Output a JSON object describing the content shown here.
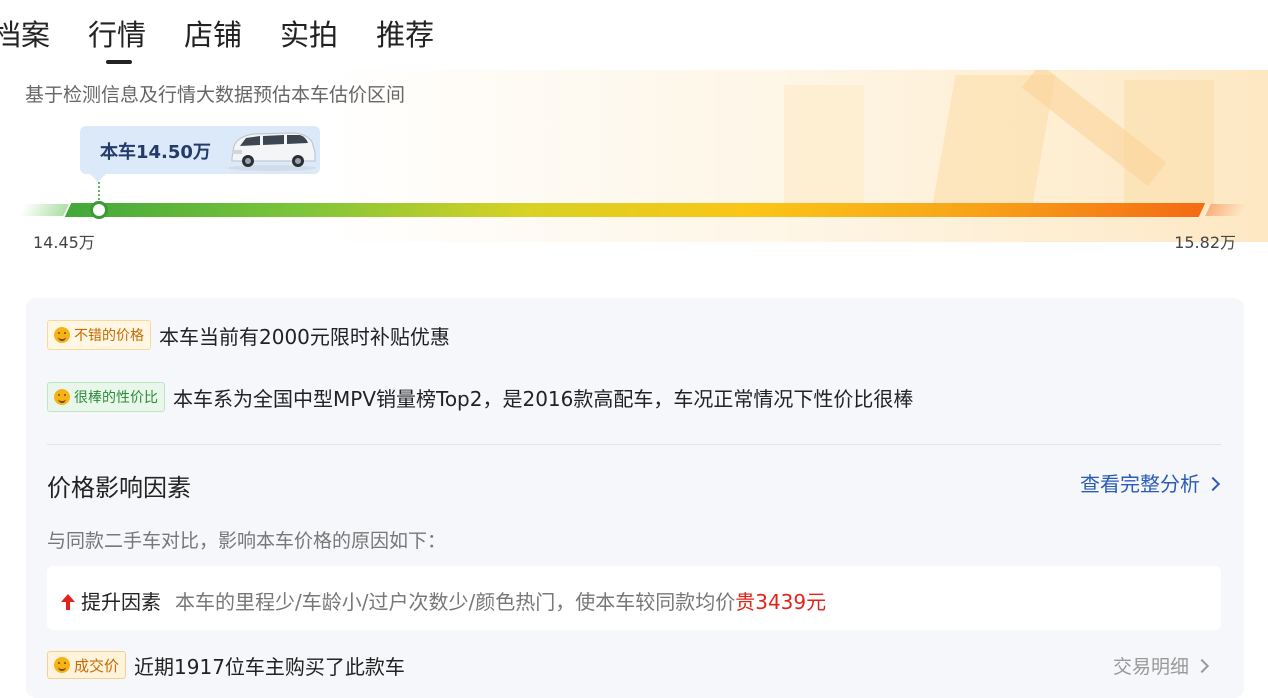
{
  "tabs": [
    {
      "label": "档案"
    },
    {
      "label": "行情"
    },
    {
      "label": "店铺"
    },
    {
      "label": "实拍"
    },
    {
      "label": "推荐"
    }
  ],
  "active_tab": "行情",
  "valuation": {
    "subtitle": "基于检测信息及行情大数据预估本车估价区间",
    "car_price_label": "本车14.50万",
    "range_min": "14.45万",
    "range_max": "15.82万"
  },
  "tags": [
    {
      "tag": "不错的价格",
      "desc": "本车当前有2000元限时补贴优惠"
    },
    {
      "tag": "很棒的性价比",
      "desc": "本车系为全国中型MPV销量榜Top2，是2016款高配车，车况正常情况下性价比很棒"
    }
  ],
  "factors": {
    "title": "价格影响因素",
    "link": "查看完整分析",
    "subtitle": "与同款二手车对比，影响本车价格的原因如下：",
    "up_label": "提升因素",
    "up_text": "本车的里程少/车龄小/过户次数少/颜色热门，使本车较同款均价",
    "up_amount": "贵3439元"
  },
  "deal": {
    "tag": "成交价",
    "text": "近期1917位车主购买了此款车",
    "link": "交易明细"
  },
  "colors": {
    "accent_blue": "#2a5cb7",
    "price_up_red": "#e2231a",
    "bar_start": "#42a83a",
    "bar_end": "#f46b14"
  }
}
